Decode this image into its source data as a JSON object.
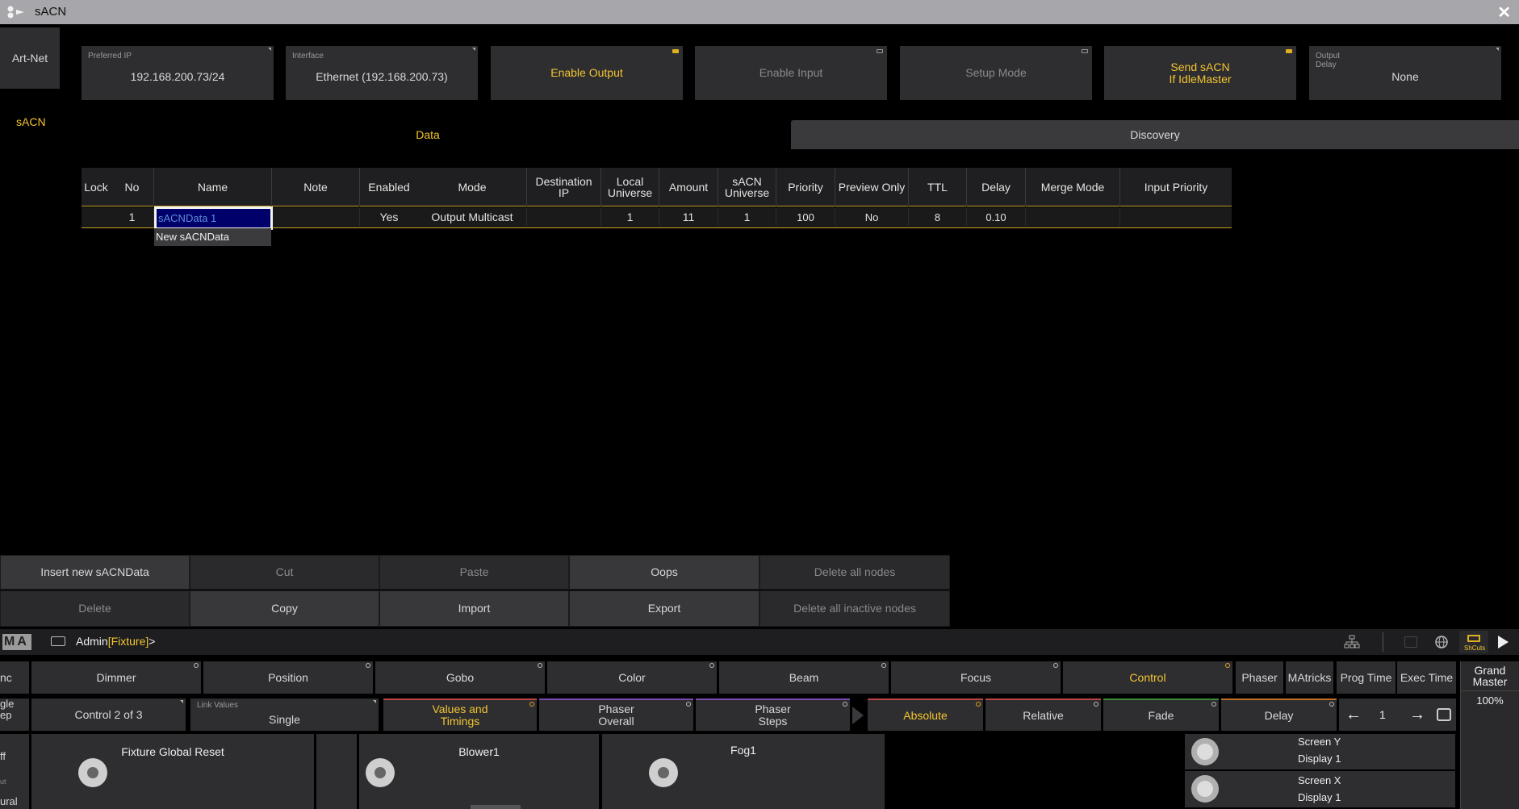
{
  "window": {
    "title": "sACN",
    "close_glyph": "✕"
  },
  "side": {
    "artnet_label": "Art-Net",
    "sacn_label": "sACN"
  },
  "top_buttons": {
    "preferred_ip_label": "Preferred IP",
    "preferred_ip_value": "192.168.200.73/24",
    "interface_label": "Interface",
    "interface_value": "Ethernet (192.168.200.73)",
    "enable_output": "Enable Output",
    "enable_input": "Enable Input",
    "setup_mode": "Setup Mode",
    "send_sacn_line1": "Send sACN",
    "send_sacn_line2": "If IdleMaster",
    "output_delay_label_1": "Output",
    "output_delay_label_2": "Delay",
    "output_delay_value": "None"
  },
  "tabs": {
    "data": "Data",
    "discovery": "Discovery"
  },
  "table": {
    "headers": {
      "lock": "Lock",
      "no": "No",
      "name": "Name",
      "note": "Note",
      "enabled": "Enabled",
      "mode": "Mode",
      "dest1": "Destination",
      "dest2": "IP",
      "local1": "Local",
      "local2": "Universe",
      "amount": "Amount",
      "sacn1": "sACN",
      "sacn2": "Universe",
      "priority": "Priority",
      "preview": "Preview Only",
      "ttl": "TTL",
      "delay": "Delay",
      "merge": "Merge Mode",
      "input_priority": "Input Priority"
    },
    "row": {
      "lock": "",
      "no": "1",
      "name": "sACNData 1",
      "note": "",
      "enabled": "Yes",
      "mode": "Output Multicast",
      "dest": "",
      "local": "1",
      "amount": "11",
      "sacn": "1",
      "priority": "100",
      "preview": "No",
      "ttl": "8",
      "delay": "0.10",
      "merge": "",
      "input_priority": ""
    },
    "new_row": "New sACNData"
  },
  "actions": {
    "insert": "Insert new sACNData",
    "cut": "Cut",
    "paste": "Paste",
    "oops": "Oops",
    "delete_all_nodes": "Delete all nodes",
    "delete": "Delete",
    "copy": "Copy",
    "import": "Import",
    "export": "Export",
    "delete_inactive": "Delete all inactive nodes"
  },
  "cmdline": {
    "logo": "MA",
    "prefix": "Admin",
    "bracket_text": "[Fixture]",
    "suffix": ">"
  },
  "features": {
    "left_clip": "nc",
    "dimmer": "Dimmer",
    "position": "Position",
    "gobo": "Gobo",
    "color": "Color",
    "beam": "Beam",
    "focus": "Focus",
    "control": "Control",
    "phaser": "Phaser",
    "matricks": "MAtricks",
    "prog_time": "Prog Time",
    "exec_time": "Exec Time",
    "grand_master_1": "Grand",
    "grand_master_2": "Master",
    "grand_master_value": "100%"
  },
  "row2": {
    "left_clip_1": "gle",
    "left_clip_2": "ep",
    "control_page": "Control 2 of 3",
    "link_label": "Link Values",
    "link_value": "Single",
    "values_timings_1": "Values and",
    "values_timings_2": "Timings",
    "phaser_overall_1": "Phaser",
    "phaser_overall_2": "Overall",
    "phaser_steps_1": "Phaser",
    "phaser_steps_2": "Steps",
    "absolute": "Absolute",
    "relative": "Relative",
    "fade": "Fade",
    "delay": "Delay",
    "step_value": "1"
  },
  "row3": {
    "left_clip_1": "ff",
    "left_clip_2": "ut",
    "left_clip_3": "ural",
    "presets": [
      "Fixture Global Reset",
      "Blower1",
      "Fog1"
    ],
    "encoders": [
      {
        "line1": "Screen Y",
        "line2": "Display 1"
      },
      {
        "line1": "Screen X",
        "line2": "Display 1"
      }
    ]
  },
  "toolbar": {
    "shortcuts": "ShCuts"
  }
}
